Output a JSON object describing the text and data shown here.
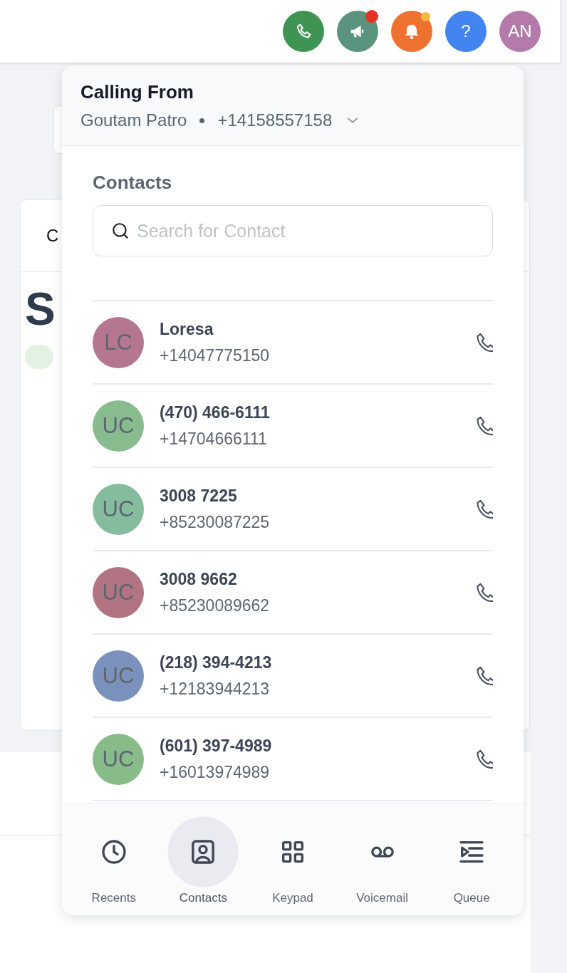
{
  "header": {
    "buttons": [
      {
        "kind": "phone",
        "color": "#3f9454"
      },
      {
        "kind": "megaphone",
        "color": "#5a937e",
        "badge": {
          "color": "#e53324"
        }
      },
      {
        "kind": "bell",
        "color": "#ef7130",
        "badge": {
          "color": "#f5b942"
        }
      },
      {
        "kind": "help",
        "color": "#4285f0",
        "label": "?"
      },
      {
        "kind": "avatar",
        "color": "#b47aa9",
        "label": "AN"
      }
    ]
  },
  "background": {
    "card_heading": "C",
    "big_text": "S"
  },
  "dialer": {
    "title": "Calling From",
    "caller_name": "Goutam Patro",
    "caller_number": "+14158557158",
    "contacts_heading": "Contacts",
    "search": {
      "placeholder": "Search for Contact"
    },
    "contacts": [
      {
        "initials": "LC",
        "color": "#b5778f",
        "name": "Loresa",
        "number": "+14047775150"
      },
      {
        "initials": "UC",
        "color": "#88bb8d",
        "name": "(470) 466-6111",
        "number": "+14704666111"
      },
      {
        "initials": "UC",
        "color": "#86bc9e",
        "name": "3008 7225",
        "number": "+85230087225"
      },
      {
        "initials": "UC",
        "color": "#b27383",
        "name": "3008 9662",
        "number": "+85230089662"
      },
      {
        "initials": "UC",
        "color": "#7a92bb",
        "name": "(218) 394-4213",
        "number": "+12183944213"
      },
      {
        "initials": "UC",
        "color": "#87bc88",
        "name": "(601) 397-4989",
        "number": "+16013974989"
      }
    ],
    "nav": [
      {
        "kind": "recents",
        "label": "Recents",
        "selected": false
      },
      {
        "kind": "contacts",
        "label": "Contacts",
        "selected": true
      },
      {
        "kind": "keypad",
        "label": "Keypad",
        "selected": false
      },
      {
        "kind": "voicemail",
        "label": "Voicemail",
        "selected": false
      },
      {
        "kind": "queue",
        "label": "Queue",
        "selected": false
      }
    ]
  }
}
